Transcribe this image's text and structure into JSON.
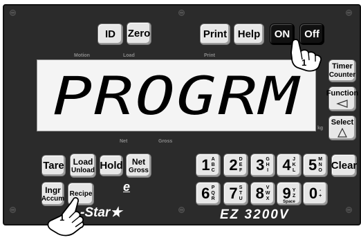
{
  "buttons": {
    "id": "ID",
    "zero": "Zero",
    "print": "Print",
    "help": "Help",
    "on": "ON",
    "off": "Off",
    "timer_line1": "Timer",
    "timer_line2": "Counter",
    "function_label": "Function",
    "select_label": "Select",
    "tare": "Tare",
    "load_line1": "Load",
    "load_line2": "Unload",
    "hold": "Hold",
    "net_line1": "Net",
    "net_line2": "Gross",
    "ingr_line1": "Ingr",
    "ingr_line2": "Accum",
    "recipe": "Recipe",
    "clear": "Clear"
  },
  "indicators": {
    "motion": "Motion",
    "load": "Load",
    "print": "Print",
    "net": "Net",
    "gross": "Gross",
    "unit": "kg"
  },
  "display": {
    "text": "PROGRM"
  },
  "keypad": [
    {
      "num": "1",
      "l1": "A",
      "l2": "B",
      "l3": "C"
    },
    {
      "num": "2",
      "l1": "D",
      "l2": "E",
      "l3": "F"
    },
    {
      "num": "3",
      "l1": "G",
      "l2": "H",
      "l3": "I"
    },
    {
      "num": "4",
      "l1": "J",
      "l2": "K",
      "l3": "L"
    },
    {
      "num": "5",
      "l1": "M",
      "l2": "N",
      "l3": "O"
    },
    {
      "num": "6",
      "l1": "P",
      "l2": "Q",
      "l3": "R"
    },
    {
      "num": "7",
      "l1": "S",
      "l2": "T",
      "l3": "U"
    },
    {
      "num": "8",
      "l1": "V",
      "l2": "W",
      "l3": "X"
    },
    {
      "num": "9",
      "l1": "Y",
      "l2": "Z",
      "l3": ""
    },
    {
      "num": "0",
      "l1": "-",
      "l2": "+",
      "l3": ""
    }
  ],
  "keypad_9_space": "Space",
  "logo_text": "e",
  "brand": "-Star",
  "model": "EZ 3200V",
  "callouts": {
    "on_button": "1",
    "recipe_button": "1"
  },
  "icons": {
    "function": "triangle-left-icon",
    "select": "triangle-up-icon",
    "star": "star-icon",
    "hand": "pointing-hand-icon"
  }
}
